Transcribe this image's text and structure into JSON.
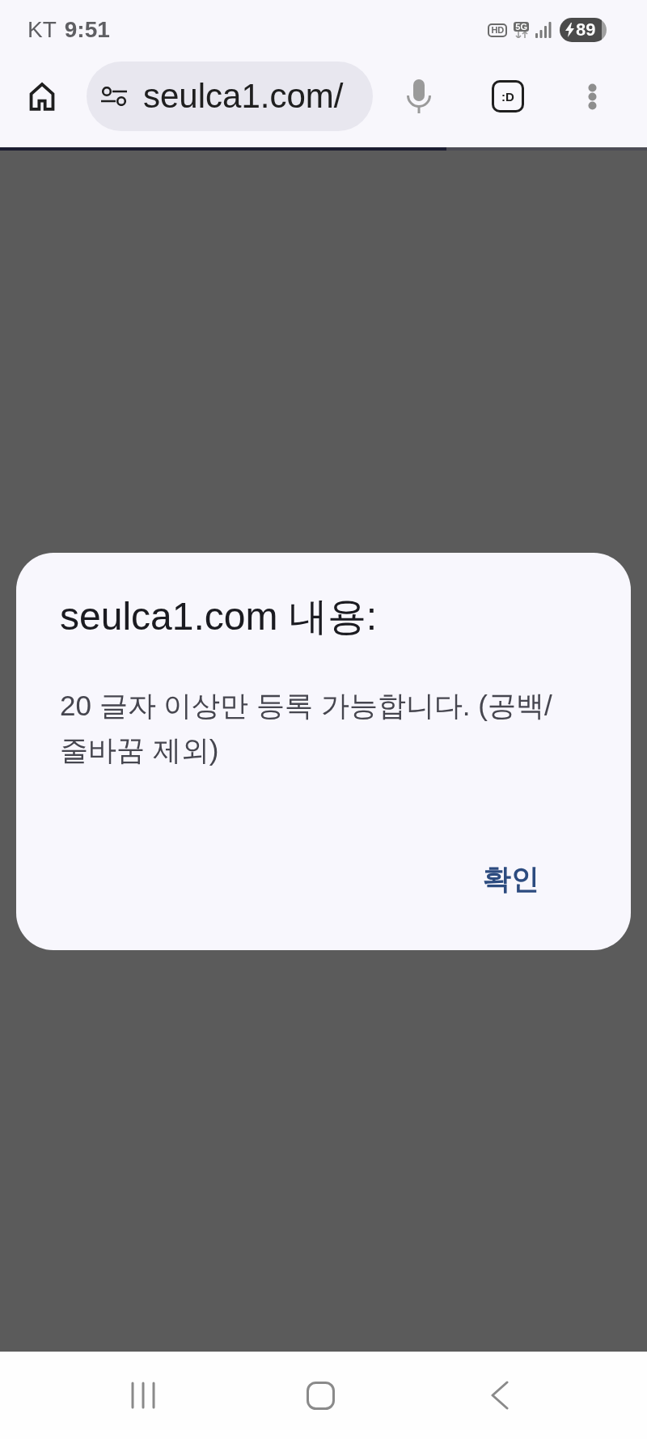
{
  "status_bar": {
    "carrier": "KT",
    "time": "9:51",
    "call_badge": "HD",
    "network": "5G",
    "battery": "89"
  },
  "toolbar": {
    "url": "seulca1.com/",
    "tab_switcher": ":D",
    "load_progress": {
      "level": 0.69
    }
  },
  "dialog": {
    "title": "seulca1.com 내용:",
    "message": "20 글자 이상만 등록 가능합니다. (공백/줄바꿈 제외)",
    "buttons": [
      {
        "label": "확인",
        "kind": "confirm"
      }
    ]
  }
}
